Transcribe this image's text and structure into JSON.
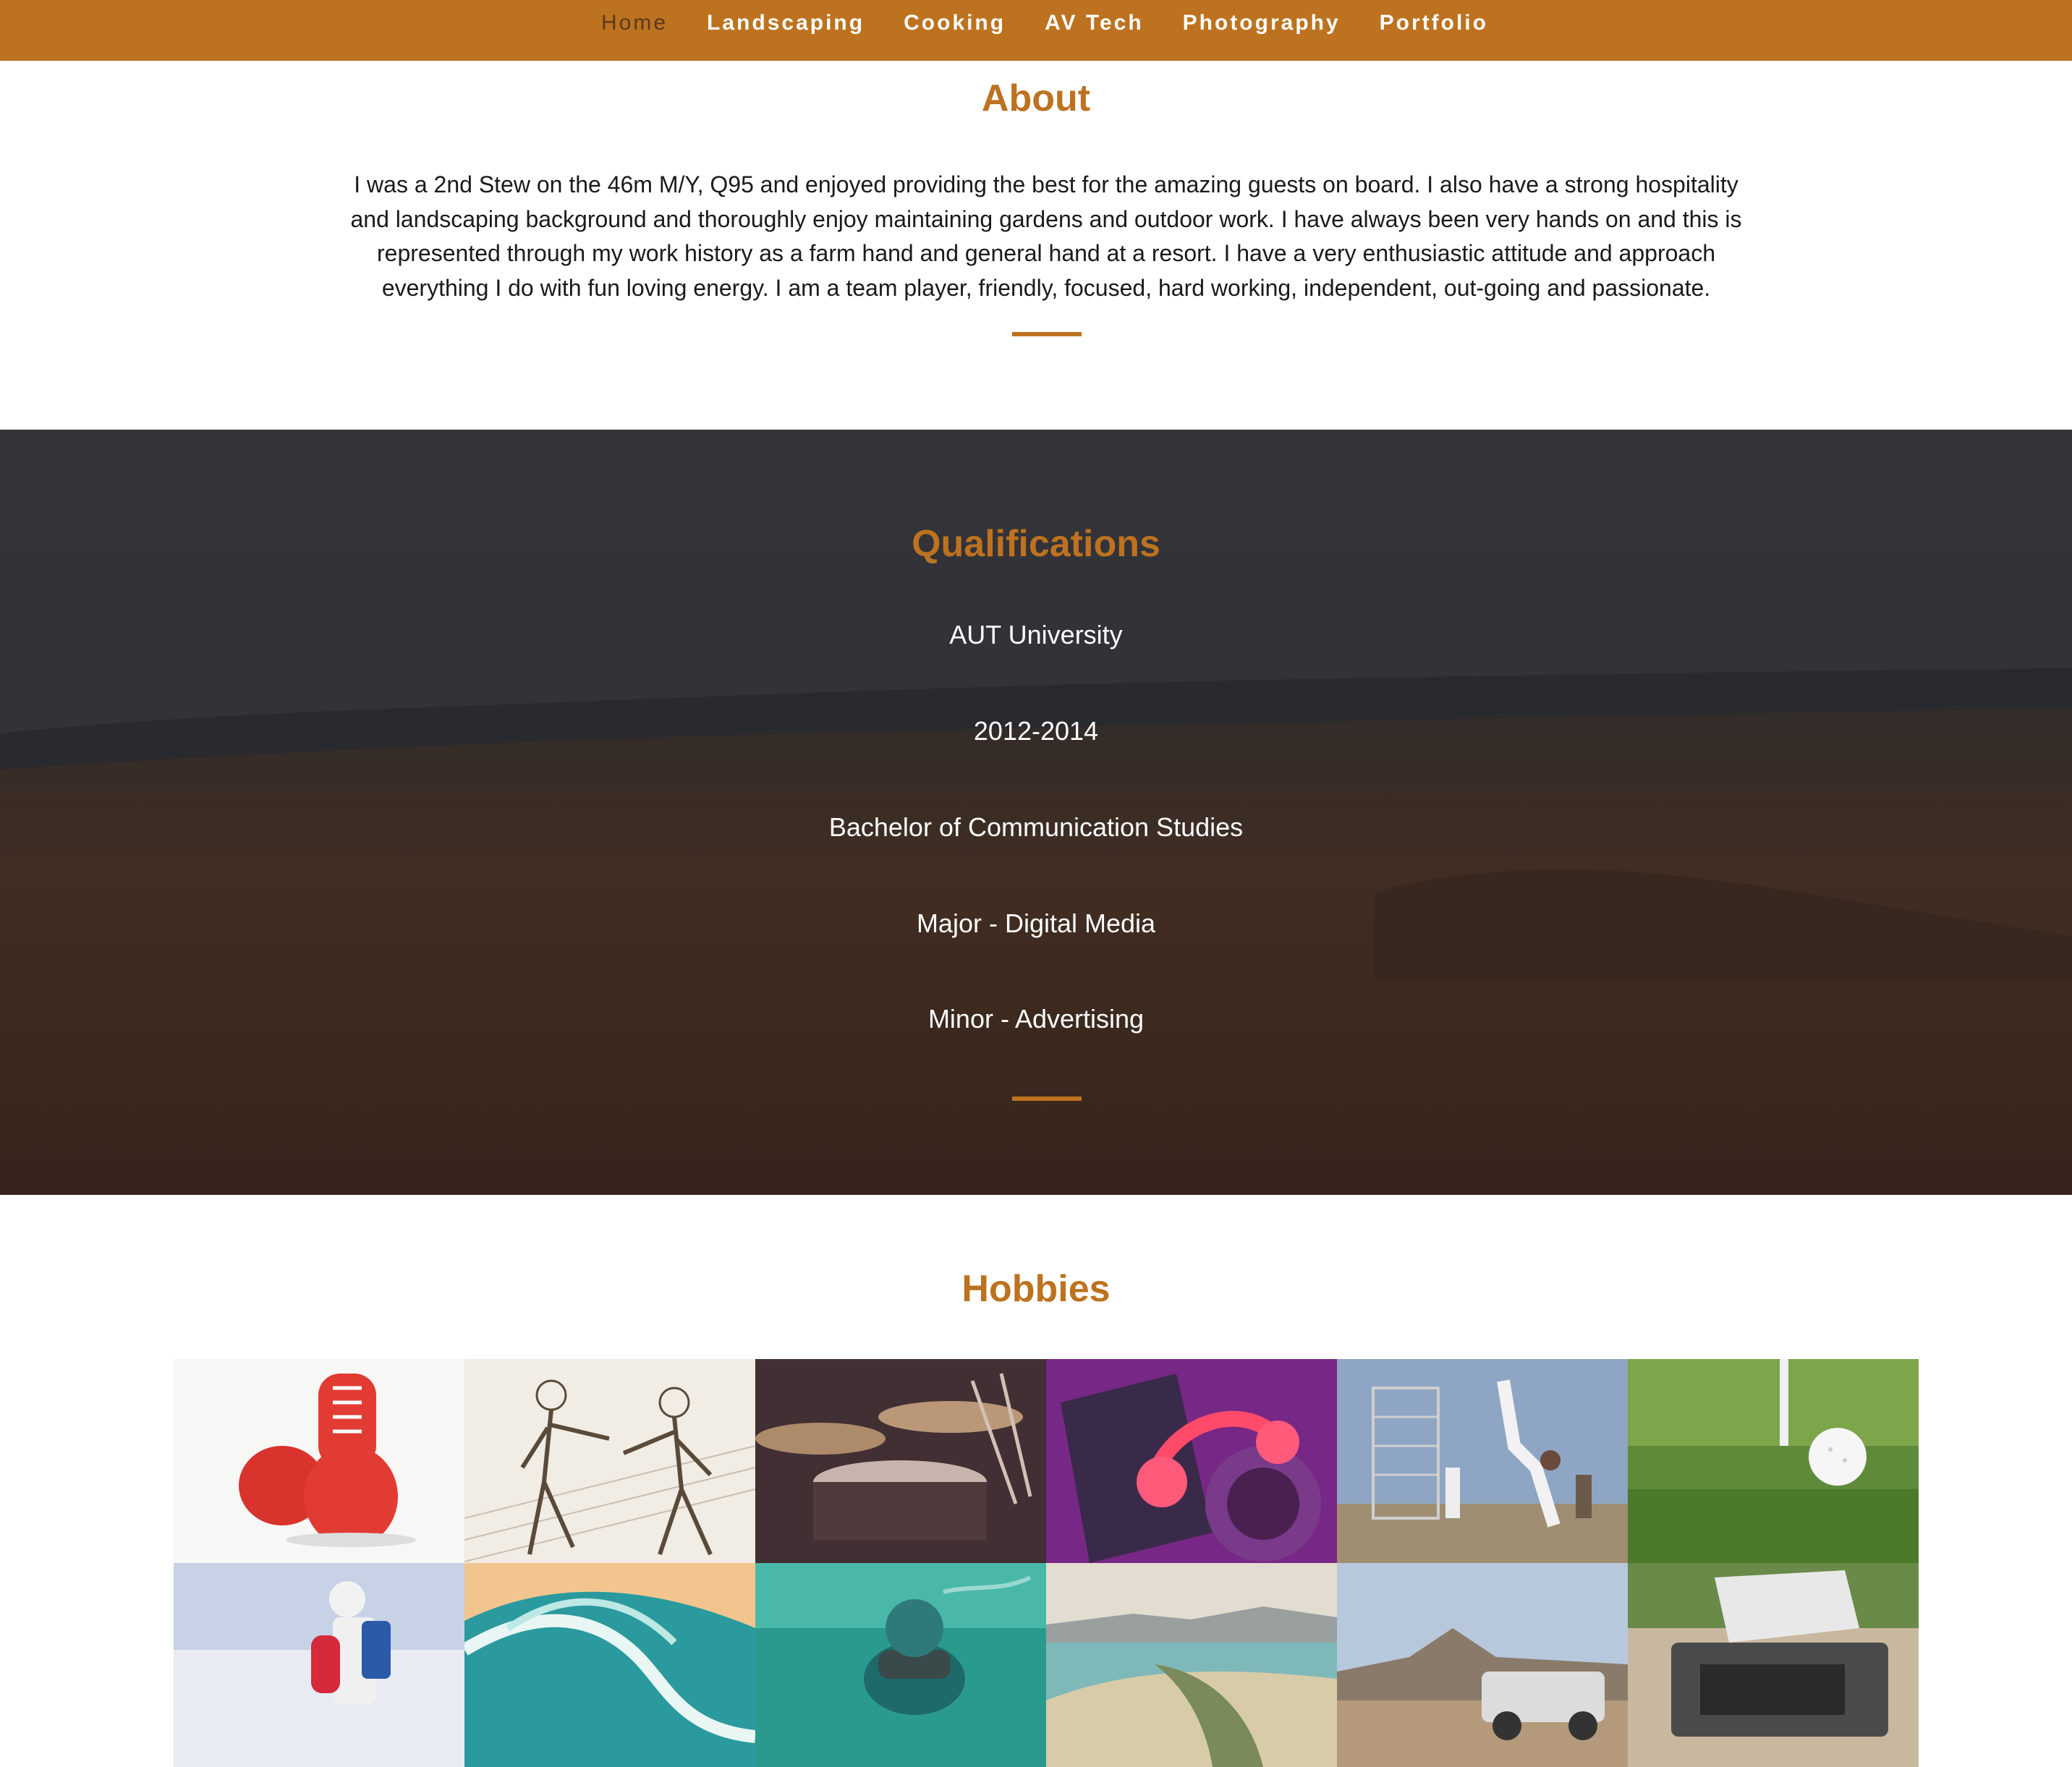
{
  "nav": {
    "items": [
      {
        "label": "Home",
        "active": true
      },
      {
        "label": "Landscaping",
        "active": false
      },
      {
        "label": "Cooking",
        "active": false
      },
      {
        "label": "AV Tech",
        "active": false
      },
      {
        "label": "Photography",
        "active": false
      },
      {
        "label": "Portfolio",
        "active": false
      }
    ]
  },
  "about": {
    "title": "About",
    "text": "I was a 2nd Stew on the 46m M/Y, Q95 and enjoyed providing the best for the amazing guests on board. I also have a strong hospitality and landscaping background and thoroughly enjoy maintaining gardens and outdoor work. I have always been very hands on and this is represented through my work history as a farm hand and general hand at a resort. I have a very enthusiastic attitude and approach everything I do with fun loving energy. I am a team player, friendly, focused, hard working, independent, out-going and passionate."
  },
  "qualifications": {
    "title": "Qualifications",
    "items": [
      "AUT University",
      "2012-2014",
      "Bachelor of Communication Studies",
      "Major - Digital Media",
      "Minor - Advertising"
    ]
  },
  "hobbies": {
    "title": "Hobbies",
    "tiles": [
      {
        "icon": "boxing-gloves-image"
      },
      {
        "icon": "martial-arts-sketch-image"
      },
      {
        "icon": "drum-kit-image"
      },
      {
        "icon": "dj-mixer-headphones-image"
      },
      {
        "icon": "breakdance-image"
      },
      {
        "icon": "golf-ball-image"
      },
      {
        "icon": "snowboarder-image"
      },
      {
        "icon": "surfing-wave-image"
      },
      {
        "icon": "diver-underwater-image"
      },
      {
        "icon": "beach-coastline-image"
      },
      {
        "icon": "offroad-car-image"
      },
      {
        "icon": "car-engine-image"
      }
    ]
  },
  "colors": {
    "accent": "#bd7220",
    "nav_active": "#5a3a1a",
    "text": "#1a1a1a"
  }
}
